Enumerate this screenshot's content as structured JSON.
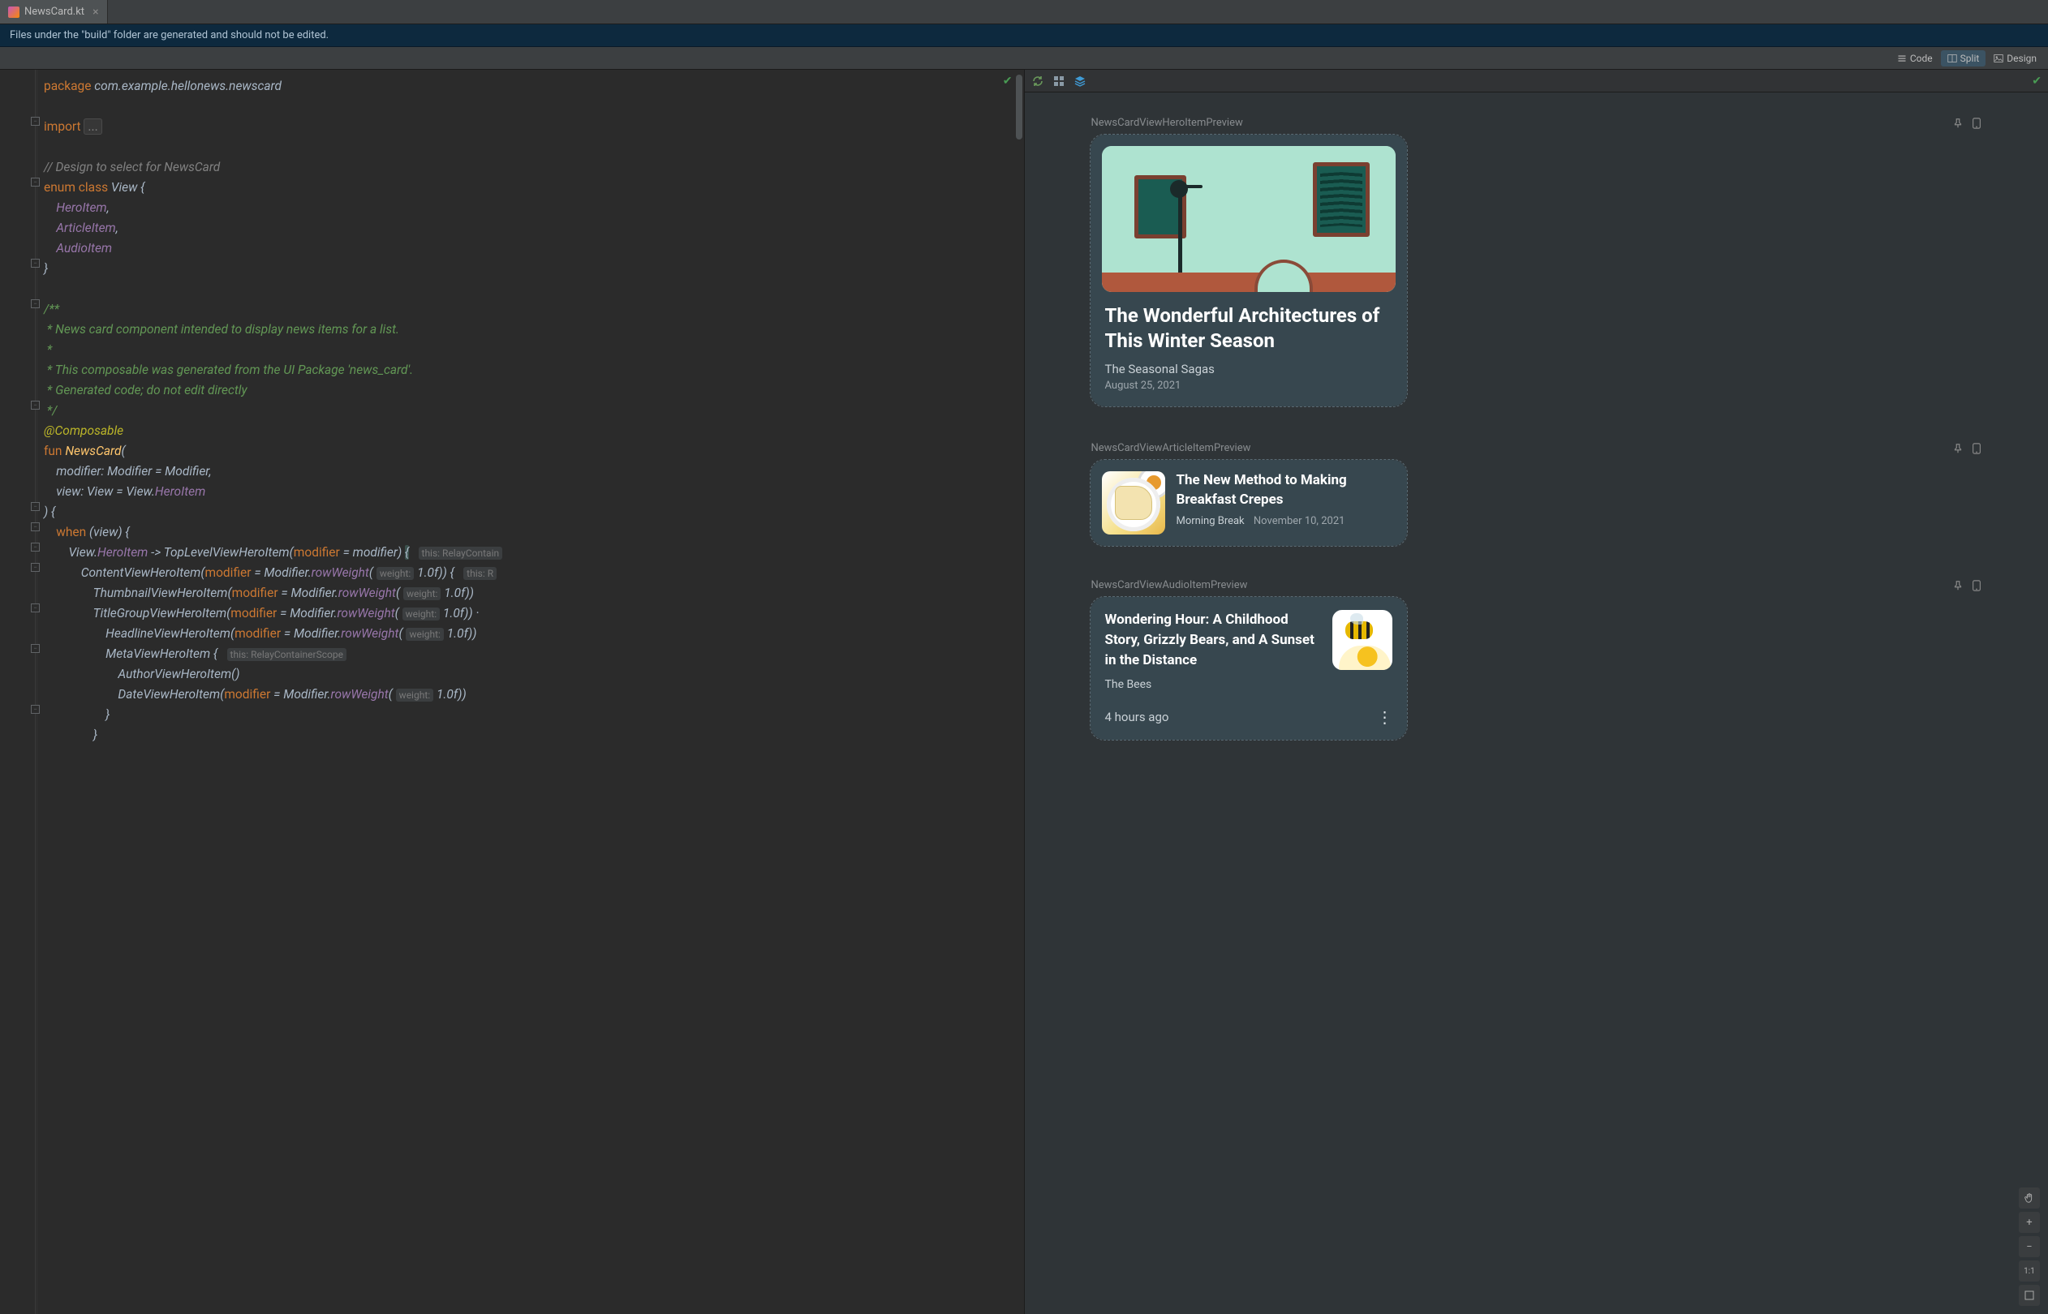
{
  "tab": {
    "filename": "NewsCard.kt"
  },
  "banner": {
    "text": "Files under the \"build\" folder are generated and should not be edited."
  },
  "viewModes": {
    "code": "Code",
    "split": "Split",
    "design": "Design",
    "active": "split"
  },
  "code": {
    "package_kw": "package",
    "package_name": "com.example.hellonews.newscard",
    "import_kw": "import",
    "import_folded": "...",
    "comment_design": "// Design to select for NewsCard",
    "enum_kw": "enum class",
    "enum_name": "View",
    "enum_items": {
      "a": "HeroItem",
      "b": "ArticleItem",
      "c": "AudioItem"
    },
    "doc": {
      "l1": "/**",
      "l2": " * News card component intended to display news items for a list.",
      "l3": " *",
      "l4": " * This composable was generated from the UI Package 'news_card'.",
      "l5": " * Generated code; do not edit directly",
      "l6": " */"
    },
    "anno": "@Composable",
    "fun_kw": "fun",
    "fun_name": "NewsCard",
    "param_modifier_name": "modifier",
    "param_modifier_type": "Modifier",
    "param_modifier_default": "Modifier",
    "param_view_name": "view",
    "param_view_type": "View",
    "param_view_default_owner": "View",
    "param_view_default_member": "HeroItem",
    "when_kw": "when",
    "when_subject": "view",
    "branch_owner": "View",
    "branch_member": "HeroItem",
    "calls": {
      "topLevel": "TopLevelViewHeroItem",
      "content": "ContentViewHeroItem",
      "thumb": "ThumbnailViewHeroItem",
      "titleGroup": "TitleGroupViewHeroItem",
      "headline": "HeadlineViewHeroItem",
      "meta": "MetaViewHeroItem",
      "author": "AuthorViewHeroItem",
      "date": "DateViewHeroItem"
    },
    "arg_modifier": "modifier",
    "eq_modifier": "modifier",
    "modifier_owner": "Modifier",
    "rowWeight": "rowWeight",
    "hint_weight": "weight:",
    "weight_val": "1.0f",
    "hint_relay": "this: RelayContain",
    "hint_relay2": "this: R",
    "hint_relay_scope": "this: RelayContainerScope"
  },
  "previews": {
    "hero": {
      "label": "NewsCardViewHeroItemPreview",
      "title": "The Wonderful Architectures of This Winter Season",
      "subtitle": "The Seasonal Sagas",
      "date": "August 25, 2021"
    },
    "article": {
      "label": "NewsCardViewArticleItemPreview",
      "title": "The New Method to Making Breakfast Crepes",
      "author": "Morning Break",
      "date": "November 10, 2021"
    },
    "audio": {
      "label": "NewsCardViewAudioItemPreview",
      "title": "Wondering Hour: A Childhood Story, Grizzly Bears, and A Sunset in the Distance",
      "author": "The Bees",
      "ago": "4 hours ago"
    }
  },
  "zoom": {
    "ratio": "1:1"
  }
}
